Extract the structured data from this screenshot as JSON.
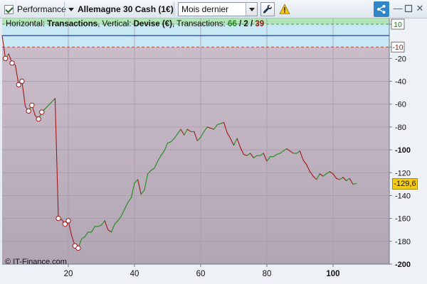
{
  "toolbar": {
    "performance_label": "Performance",
    "instrument_label": "Allemagne 30 Cash (1€)",
    "period_value": "Mois dernier"
  },
  "header": {
    "prefix": "Horizontal: ",
    "horizontal_value": "Transactions",
    "vertical_label": ", Vertical: ",
    "vertical_value": "Devise (€)",
    "transactions_label": ", Transactions: ",
    "total": "66",
    "slash1": " / ",
    "winners": "2",
    "slash2": " / ",
    "losers": "39"
  },
  "copyright": "© IT-Finance.com",
  "last_value_label": "-129,6",
  "colors": {
    "up_line": "#1f8b1f",
    "down_line": "#a01818",
    "gain_zone": "#b2e6b8",
    "neutral_zone": "#c8e8f4",
    "loss_zone_top": "#cbbcc9",
    "loss_zone_bottom": "#b2a6b4",
    "badge": "#f5cc14"
  },
  "chart_data": {
    "type": "line",
    "xlim": [
      0,
      117
    ],
    "ylim": [
      -200,
      15
    ],
    "x_ticks": [
      20,
      40,
      60,
      80,
      100
    ],
    "x_tick_labels": [
      "20",
      "40",
      "60",
      "80",
      "100"
    ],
    "y_ticks": [
      10,
      -10,
      -20,
      -40,
      -60,
      -80,
      -100,
      -120,
      -140,
      -160,
      -180,
      -200
    ],
    "y_tick_labels": [
      "10",
      "-10",
      "-20",
      "-40",
      "-60",
      "-80",
      "-100",
      "-120",
      "-140",
      "-160",
      "-180",
      "-200"
    ],
    "zero_line": 0,
    "upper_threshold": 10,
    "lower_threshold": -10,
    "last_value": -129.6,
    "marked_points": [
      1,
      3,
      5,
      6,
      8,
      9,
      11,
      12,
      17,
      19,
      20,
      22,
      23
    ],
    "x": [
      0,
      1,
      2,
      3,
      4,
      5,
      6,
      7,
      8,
      9,
      10,
      11,
      12,
      13,
      14,
      15,
      16,
      17,
      18,
      19,
      20,
      21,
      22,
      23,
      24,
      25,
      26,
      27,
      28,
      29,
      30,
      31,
      32,
      33,
      34,
      35,
      36,
      37,
      38,
      39,
      40,
      41,
      42,
      43,
      44,
      45,
      46,
      47,
      48,
      49,
      50,
      51,
      52,
      53,
      54,
      55,
      56,
      57,
      58,
      59,
      60,
      61,
      62,
      63,
      64,
      65,
      66,
      67,
      68,
      69,
      70,
      71,
      72,
      73,
      74,
      75,
      76,
      77,
      78,
      79,
      80,
      81,
      82,
      83,
      84,
      85,
      86,
      87,
      88,
      89,
      90,
      91,
      92,
      93,
      94,
      95,
      96,
      97,
      98,
      99,
      100,
      101,
      102,
      103,
      104,
      105,
      106,
      107
    ],
    "y": [
      0,
      -20,
      -16,
      -24,
      -26,
      -43,
      -40,
      -62,
      -66,
      -61,
      -70,
      -73,
      -67,
      -64,
      -61,
      -58,
      -55,
      -160,
      -161,
      -165,
      -162,
      -175,
      -184,
      -186,
      -178,
      -176,
      -172,
      -172,
      -167,
      -167,
      -166,
      -162,
      -170,
      -172,
      -165,
      -162,
      -158,
      -152,
      -146,
      -142,
      -129,
      -126,
      -139,
      -135,
      -121,
      -118,
      -116,
      -110,
      -105,
      -101,
      -94,
      -93,
      -90,
      -86,
      -82,
      -87,
      -82,
      -84,
      -84,
      -92,
      -89,
      -84,
      -80,
      -81,
      -82,
      -78,
      -77,
      -76,
      -85,
      -90,
      -96,
      -90,
      -98,
      -104,
      -105,
      -103,
      -107,
      -105,
      -105,
      -103,
      -110,
      -106,
      -106,
      -104,
      -103,
      -101,
      -99,
      -101,
      -103,
      -103,
      -101,
      -109,
      -113,
      -119,
      -123,
      -126,
      -121,
      -123,
      -121,
      -119,
      -121,
      -125,
      -126,
      -124,
      -127,
      -125,
      -130,
      -129.6
    ]
  }
}
